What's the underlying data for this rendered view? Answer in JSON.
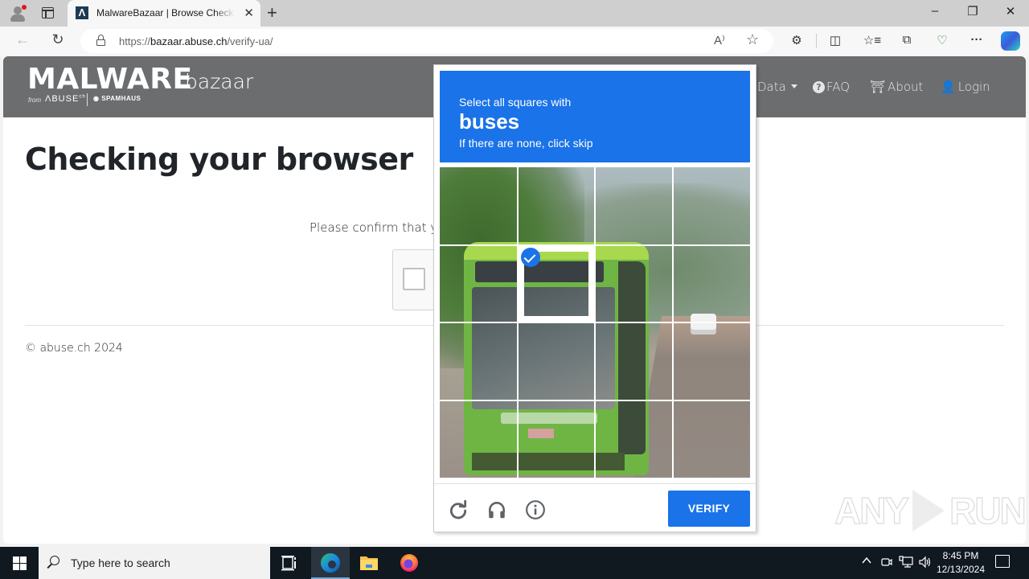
{
  "browser": {
    "tab": {
      "title": "MalwareBazaar | Browse Checking your browser",
      "favicon_letter": "Λ"
    },
    "new_tab_label": "+",
    "window_controls": {
      "minimize": "–",
      "restore": "❐",
      "close": "✕"
    },
    "address": {
      "scheme": "https://",
      "host": "bazaar.abuse.ch",
      "path": "/verify-ua/"
    },
    "icons": {
      "back": "←",
      "refresh": "↻",
      "read_aloud": "A⁾",
      "favorite": "☆",
      "extensions": "⚙",
      "split_screen": "◫",
      "favorites": "☆≡",
      "collections": "⧉",
      "browser_essentials": "♡",
      "more": "···"
    }
  },
  "site": {
    "logo": {
      "main": "MALWARE",
      "sub": "bazaar",
      "from": "from",
      "abuse": "ΛBUSE",
      "abuse_sup": "ch",
      "spamhaus": "SPAMHAUS"
    },
    "nav": [
      {
        "label": "Data",
        "icon": "caret-down"
      },
      {
        "label": "FAQ",
        "icon": "question-circle"
      },
      {
        "label": "About",
        "icon": "building"
      },
      {
        "label": "Login",
        "icon": "user"
      }
    ],
    "heading": "Checking your browser",
    "confirm_text": "Please confirm that you are not a robot",
    "copyright": "© abuse.ch 2024",
    "watermark": {
      "left": "ANY",
      "right": "RUN"
    }
  },
  "challenge": {
    "instruction": "Select all squares with",
    "target": "buses",
    "hint": "If there are none, click skip",
    "grid": {
      "rows": 4,
      "cols": 4,
      "selected": [
        [
          1,
          1
        ]
      ]
    },
    "footer": {
      "reload_icon": "reload",
      "audio_icon": "headphones",
      "info_icon": "info",
      "verify_label": "VERIFY"
    },
    "accent_color": "#1a73e8"
  },
  "taskbar": {
    "search_placeholder": "Type here to search",
    "apps": [
      "task-view",
      "edge",
      "file-explorer",
      "firefox"
    ],
    "tray": {
      "chevron": "^",
      "time": "8:45 PM",
      "date": "12/13/2024"
    }
  }
}
